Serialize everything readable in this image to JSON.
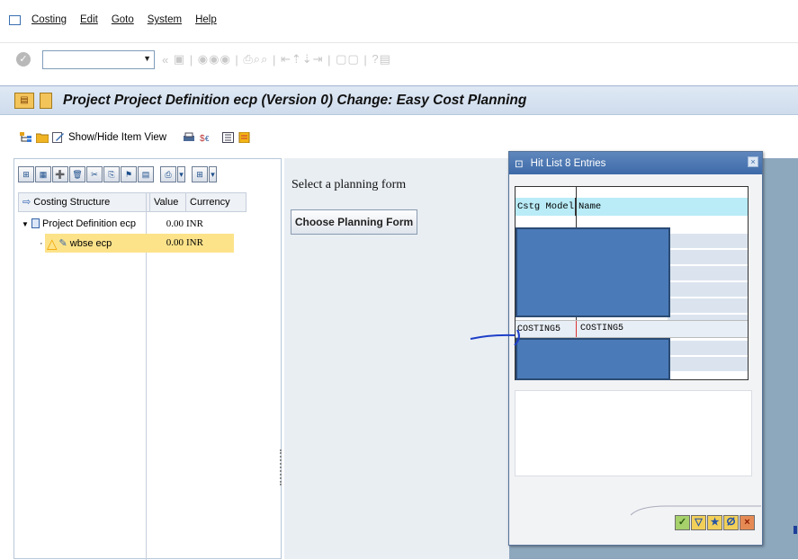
{
  "menu": {
    "items": [
      "Costing",
      "Edit",
      "Goto",
      "System",
      "Help"
    ]
  },
  "command_field": {
    "value": ""
  },
  "title_bar": {
    "title": "Project Project Definition ecp (Version 0) Change: Easy Cost Planning"
  },
  "app_toolbar": {
    "show_hide_label": "Show/Hide Item View"
  },
  "tree": {
    "headers": [
      "Costing Structure",
      "Value",
      "Currency"
    ],
    "rows": [
      {
        "label": "Project Definition ecp",
        "value": "0.00",
        "currency": "INR"
      },
      {
        "label": "wbse ecp",
        "value": "0.00",
        "currency": "INR"
      }
    ]
  },
  "workarea": {
    "prompt": "Select a planning form",
    "choose_button": "Choose Planning Form"
  },
  "hit_list": {
    "title": "Hit List 8 Entries",
    "col_model": "Cstg Model",
    "col_name": "Name",
    "row_model": "COSTING5",
    "row_name": "COSTING5"
  },
  "colors": {
    "title_bg": "#d8e3f0",
    "dialog_title": "#4a75b0",
    "workarea_bg": "#8da7bd",
    "redaction": "#4a7ab8",
    "selected_row": "#fce38a"
  }
}
